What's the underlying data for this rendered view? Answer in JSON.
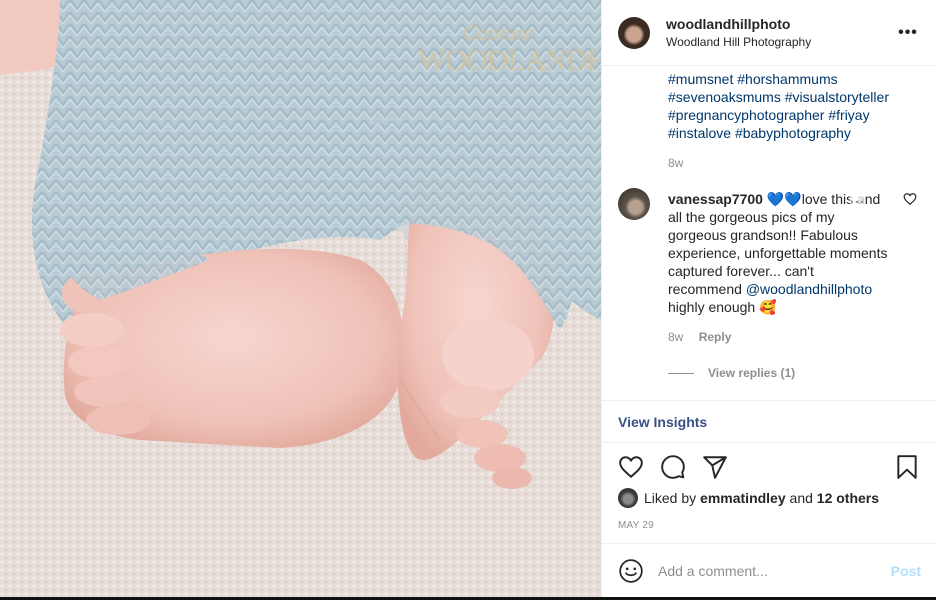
{
  "photo": {
    "alt_icon": "baby-feet-photo",
    "watermark_script": "Capture",
    "watermark_main": "WOODLANDHI"
  },
  "post": {
    "username": "woodlandhillphoto",
    "subtitle": "Woodland Hill Photography",
    "more_icon": "more-horizontal-icon",
    "caption_hashtags": [
      [
        "#mumsnet",
        "#horshammums"
      ],
      [
        "#sevenoaksmums",
        "#visualstoryteller"
      ],
      [
        "#pregnancyphotographer",
        "#friyay"
      ],
      [
        "#instalove",
        "#babyphotography"
      ]
    ],
    "caption_time": "8w"
  },
  "comment": {
    "username": "vanessap7700",
    "hearts": "💙💙",
    "text_1": "love this and all the gorgeous pics of my gorgeous grandson!! Fabulous experience, unforgettable moments captured forever... can't recommend",
    "mention": "@woodlandhillphoto",
    "text_2": "highly enough",
    "emoji": "🥰",
    "more": "...",
    "time": "8w",
    "reply_label": "Reply",
    "view_replies": "View replies (1)"
  },
  "insights_label": "View Insights",
  "likes": {
    "prefix": "Liked by",
    "user": "emmatindley",
    "and": "and",
    "others": "12 others"
  },
  "date": "MAY 29",
  "add_comment": {
    "placeholder": "Add a comment...",
    "post_label": "Post"
  },
  "colors": {
    "link": "#00376b",
    "insights": "#385185",
    "post_disabled": "#b2dffc",
    "muted": "#8e8e8e"
  }
}
